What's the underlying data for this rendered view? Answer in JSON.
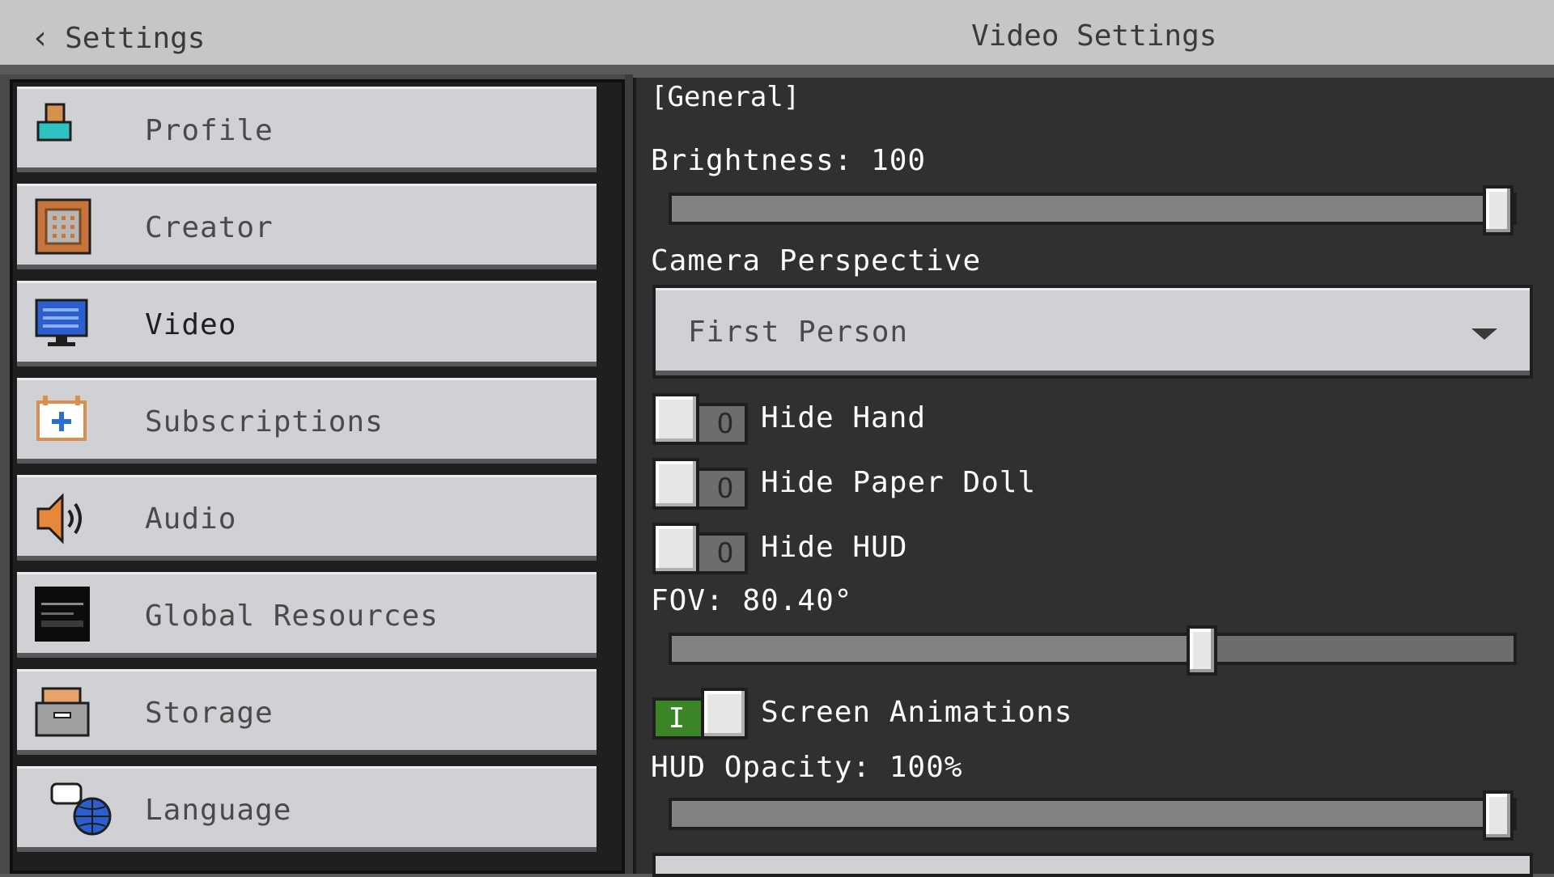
{
  "topbar": {
    "back_label": "Settings",
    "title": "Video Settings"
  },
  "nav": {
    "items": [
      {
        "label": "Profile",
        "icon": "profile-icon"
      },
      {
        "label": "Creator",
        "icon": "creator-icon"
      },
      {
        "label": "Video",
        "icon": "video-monitor-icon",
        "active": true
      },
      {
        "label": "Subscriptions",
        "icon": "subscriptions-icon"
      },
      {
        "label": "Audio",
        "icon": "speaker-icon"
      },
      {
        "label": "Global Resources",
        "icon": "global-resources-icon"
      },
      {
        "label": "Storage",
        "icon": "storage-box-icon"
      },
      {
        "label": "Language",
        "icon": "language-globe-icon"
      }
    ]
  },
  "video": {
    "section": "[General]",
    "brightness": {
      "label": "Brightness: 100",
      "value": 1.0
    },
    "camera": {
      "label": "Camera Perspective",
      "value": "First Person"
    },
    "toggles": [
      {
        "label": "Hide Hand",
        "state": "O",
        "on": false
      },
      {
        "label": "Hide Paper Doll",
        "state": "O",
        "on": false
      },
      {
        "label": "Hide HUD",
        "state": "O",
        "on": false
      }
    ],
    "fov": {
      "label": "FOV: 80.40°",
      "value": 0.63
    },
    "screen_animations": {
      "label": "Screen Animations",
      "state": "I",
      "on": true
    },
    "hud_opacity": {
      "label": "HUD Opacity: 100%",
      "value": 1.0
    }
  },
  "colors": {
    "accent_on": "#3c8527",
    "button_face": "#d0d1d4",
    "panel_bg": "#303032"
  }
}
